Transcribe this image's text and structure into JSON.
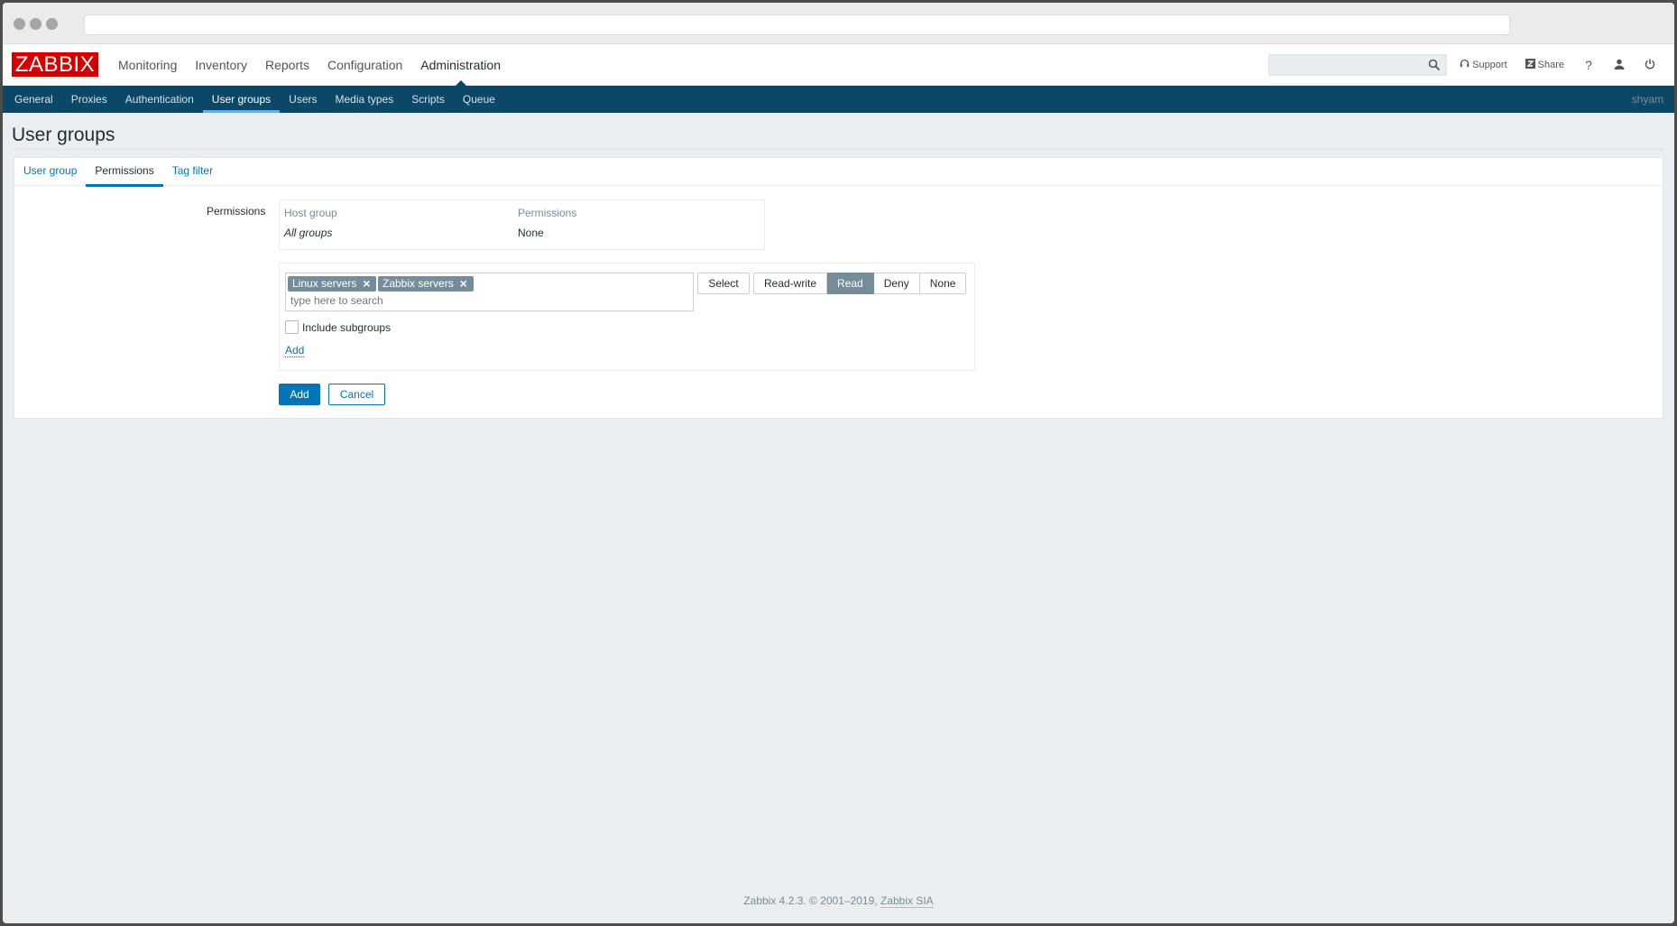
{
  "brand": {
    "logo_text": "ZABBIX",
    "logo_color": "#d40000"
  },
  "main_menu": [
    {
      "label": "Monitoring"
    },
    {
      "label": "Inventory"
    },
    {
      "label": "Reports"
    },
    {
      "label": "Configuration"
    },
    {
      "label": "Administration",
      "active": true
    }
  ],
  "header_right": {
    "search": {
      "value": "",
      "placeholder": ""
    },
    "support_label": "Support",
    "share_label": "Share",
    "help_label": "?"
  },
  "sub_menu": [
    {
      "label": "General"
    },
    {
      "label": "Proxies"
    },
    {
      "label": "Authentication"
    },
    {
      "label": "User groups",
      "active": true
    },
    {
      "label": "Users"
    },
    {
      "label": "Media types"
    },
    {
      "label": "Scripts"
    },
    {
      "label": "Queue"
    }
  ],
  "current_user": "shyam",
  "page_title": "User groups",
  "tabs": [
    {
      "label": "User group"
    },
    {
      "label": "Permissions",
      "active": true
    },
    {
      "label": "Tag filter"
    }
  ],
  "form": {
    "permissions_label": "Permissions",
    "table": {
      "headers": [
        "Host group",
        "Permissions"
      ],
      "rows": [
        {
          "group": "All groups",
          "permission": "None"
        }
      ]
    },
    "selected_groups": [
      "Linux servers",
      "Zabbix servers"
    ],
    "search_placeholder": "type here to search",
    "select_button": "Select",
    "permission_options": [
      "Read-write",
      "Read",
      "Deny",
      "None"
    ],
    "selected_permission": "Read",
    "include_subgroups_label": "Include subgroups",
    "include_subgroups_checked": false,
    "add_link": "Add",
    "add_button": "Add",
    "cancel_button": "Cancel"
  },
  "footer": {
    "text": "Zabbix 4.2.3. © 2001–2019,",
    "link": "Zabbix SIA"
  },
  "colors": {
    "subnav_bg": "#0b4766",
    "accent": "#0275b8",
    "active_toggle": "#768d99"
  }
}
